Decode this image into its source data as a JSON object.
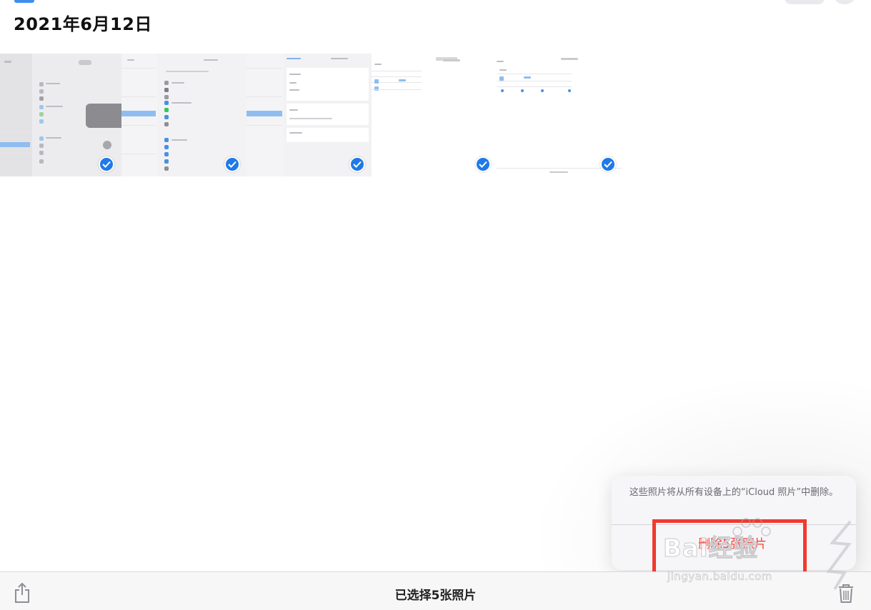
{
  "header": {
    "date_title": "2021年6月12日"
  },
  "thumbnails": [
    {
      "name": "screenshot-1",
      "selected": true
    },
    {
      "name": "screenshot-2",
      "selected": true
    },
    {
      "name": "screenshot-3",
      "selected": true
    },
    {
      "name": "screenshot-4",
      "selected": true
    },
    {
      "name": "screenshot-5",
      "selected": true
    }
  ],
  "action_sheet": {
    "message": "这些照片将从所有设备上的“iCloud 照片”中删除。",
    "delete_label": "删除5张照片"
  },
  "toolbar": {
    "selection_label": "已选择5张照片",
    "share_icon": "share-icon",
    "trash_icon": "trash-icon"
  },
  "watermark": {
    "brand": "Bai经验",
    "url": "jingyan.baidu.com"
  },
  "colors": {
    "accent": "#1f7ae8",
    "destructive": "#ff3b30",
    "highlight_box": "#f03a2e"
  }
}
